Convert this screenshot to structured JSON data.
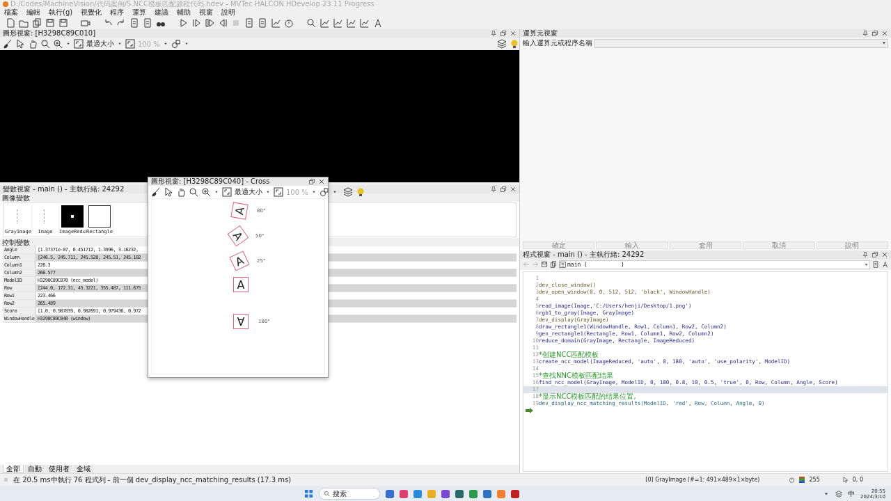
{
  "window": {
    "title": "D:/Codes/MachineVision/代码案例/5.NCC模板匹配源程代码.hdev - MVTec HALCON HDevelop 23.11 Progress"
  },
  "menu": [
    "檔案",
    "編輯",
    "執行(g)",
    "視覺化",
    "程序",
    "運算",
    "建議",
    "輔助",
    "視窗",
    "說明"
  ],
  "graphics_window": {
    "title": "圖形視窗: [H3298C89C010]",
    "zoom_mode": "最適大小",
    "zoom": "100 %"
  },
  "variables_window": {
    "title": "變數視窗 - main () - 主執行緒: 24292",
    "iconic_label": "圖像變數",
    "iconic": [
      {
        "name": "GrayImage",
        "kind": "dots"
      },
      {
        "name": "Image",
        "kind": "dots"
      },
      {
        "name": "ImageRedu",
        "kind": "black"
      },
      {
        "name": "Rectangle",
        "kind": "outline"
      }
    ],
    "control_label": "控制變數",
    "control": [
      {
        "name": "Angle",
        "value": "[1.37371e-07, 0.451712, 1.3996, 3.16232,"
      },
      {
        "name": "Column",
        "value": "[246.5, 245.711, 245.528, 245.51, 245.102"
      },
      {
        "name": "Column1",
        "value": "226.3"
      },
      {
        "name": "Column2",
        "value": "266.577"
      },
      {
        "name": "ModelID",
        "value": "H3298C89C070 (ncc_model)"
      },
      {
        "name": "Row",
        "value": "[244.0, 172.31, 45.3221, 355.487, 111.675"
      },
      {
        "name": "Row1",
        "value": "223.466"
      },
      {
        "name": "Row2",
        "value": "265.489"
      },
      {
        "name": "Score",
        "value": "[1.0, 0.987839, 0.982691, 0.979436, 0.972"
      },
      {
        "name": "WindowHandle",
        "value": "H3298C89C040 (window)"
      }
    ],
    "tabs": [
      {
        "label": "全部",
        "selected": true
      },
      {
        "label": "自動",
        "selected": false
      },
      {
        "label": "使用者",
        "selected": false
      },
      {
        "label": "全域",
        "selected": false
      }
    ]
  },
  "floating_window": {
    "title": "圖形視窗: [H3298C89C040] - Cross",
    "zoom_mode": "最適大小",
    "zoom": "100 %",
    "items": [
      {
        "glyph": "A",
        "label": "80°"
      },
      {
        "glyph": "A",
        "label": "50°"
      },
      {
        "glyph": "A",
        "label": "25°"
      },
      {
        "glyph": "A"
      },
      {
        "glyph": "A",
        "label": "180°"
      }
    ]
  },
  "operator_window": {
    "title": "運算元視窗",
    "input_label": "輸入運算元或程序名稱",
    "buttons": [
      "確定",
      "輸入",
      "套用",
      "取消",
      "說明"
    ]
  },
  "program_window": {
    "title": "程式視窗 - main () - 主執行緒: 24292",
    "procedure": "main (          )",
    "lines": [
      {
        "num": "1",
        "kind": "blank",
        "selected": false
      },
      {
        "num": "2",
        "text": "dev_close_window()",
        "kind": "dev",
        "selected": false
      },
      {
        "num": "3",
        "text": "dev_open_window(0, 0, 512, 512, 'black', WindowHandle)",
        "kind": "dev",
        "selected": false
      },
      {
        "num": "4",
        "kind": "blank",
        "selected": false
      },
      {
        "num": "5",
        "text": "read_image(Image,'C:/Users/henji/Desktop/1.png')",
        "kind": "operator",
        "selected": false
      },
      {
        "num": "6",
        "text": "rgb1_to_gray(Image, GrayImage)",
        "kind": "operator",
        "selected": false
      },
      {
        "num": "7",
        "text": "dev_display(GrayImage)",
        "kind": "dev",
        "selected": false
      },
      {
        "num": "8",
        "text": "draw_rectangle1(WindowHandle, Row1, Column1, Row2, Column2)",
        "kind": "operator",
        "selected": false
      },
      {
        "num": "9",
        "text": "gen_rectangle1(Rectangle, Row1, Column1, Row2, Column2)",
        "kind": "operator",
        "selected": false
      },
      {
        "num": "10",
        "text": "reduce_domain(GrayImage, Rectangle, ImageReduced)",
        "kind": "operator",
        "selected": false
      },
      {
        "num": "11",
        "kind": "blank",
        "selected": false
      },
      {
        "num": "12",
        "text": "*创建NCC匹配模板",
        "kind": "comment",
        "selected": false
      },
      {
        "num": "13",
        "text": "create_ncc_model(ImageReduced, 'auto', 0, 180, 'auto', 'use_polarity', ModelID)",
        "kind": "operator",
        "selected": false
      },
      {
        "num": "14",
        "kind": "blank",
        "selected": false
      },
      {
        "num": "15",
        "text": "*查找NNC模板匹配结果",
        "kind": "comment",
        "selected": false
      },
      {
        "num": "16",
        "text": "find_ncc_model(GrayImage, ModelID, 0, 180, 0.8, 10, 0.5, 'true', 0, Row, Column, Angle, Score)",
        "kind": "operator",
        "selected": false
      },
      {
        "num": "17",
        "kind": "blank",
        "selected": true
      },
      {
        "num": "18",
        "text": "*显示NCC模板匹配的结果位置,",
        "kind": "comment",
        "selected": false
      },
      {
        "num": "19",
        "text": "dev_display_ncc_matching_results(ModelID, 'red', Row, Column, Angle, 0)",
        "kind": "procedure",
        "selected": false
      }
    ]
  },
  "status_bar": {
    "message": "在 20.5 ms中執行 76 程式列 - 前一個   dev_display_ncc_matching_results (17.3 ms)",
    "image_info": "[0] GrayImage (#=1: 491×489×1×byte)",
    "gray": "255",
    "coords": "0, 0"
  },
  "taskbar": {
    "search": "搜索",
    "ime": "中",
    "time": "20:55",
    "date": "2024/3/10"
  }
}
